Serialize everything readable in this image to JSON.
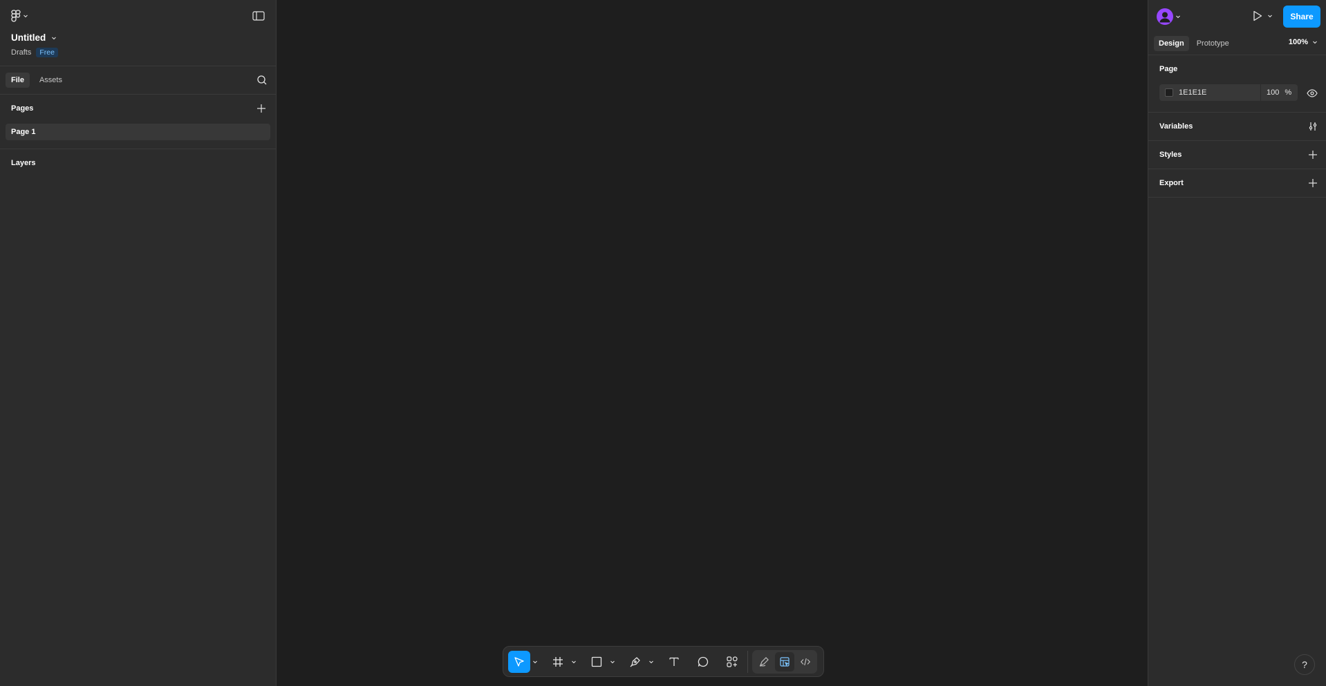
{
  "file": {
    "title": "Untitled",
    "location": "Drafts",
    "plan_badge": "Free"
  },
  "left_tabs": [
    "File",
    "Assets"
  ],
  "pages": {
    "header": "Pages",
    "items": [
      "Page 1"
    ]
  },
  "layers": {
    "header": "Layers"
  },
  "right_tabs": [
    "Design",
    "Prototype"
  ],
  "zoom": "100%",
  "share_label": "Share",
  "page_section": {
    "header": "Page",
    "fill_hex": "1E1E1E",
    "opacity": "100",
    "opacity_unit": "%"
  },
  "sections": [
    "Variables",
    "Styles",
    "Export"
  ],
  "help_label": "?",
  "colors": {
    "accent": "#0d99ff",
    "panel": "#2c2c2c",
    "canvas": "#1e1e1e",
    "avatar": "#9747ff",
    "badge_text": "#7cc4ff"
  },
  "toolbar": {
    "tools": [
      "move-tool",
      "frame-tool",
      "rectangle-tool",
      "pen-tool",
      "text-tool",
      "comment-tool",
      "actions-tool"
    ],
    "modes": [
      "draw-mode",
      "design-mode",
      "dev-mode"
    ],
    "active_tool": "move-tool",
    "active_mode": "design-mode"
  }
}
